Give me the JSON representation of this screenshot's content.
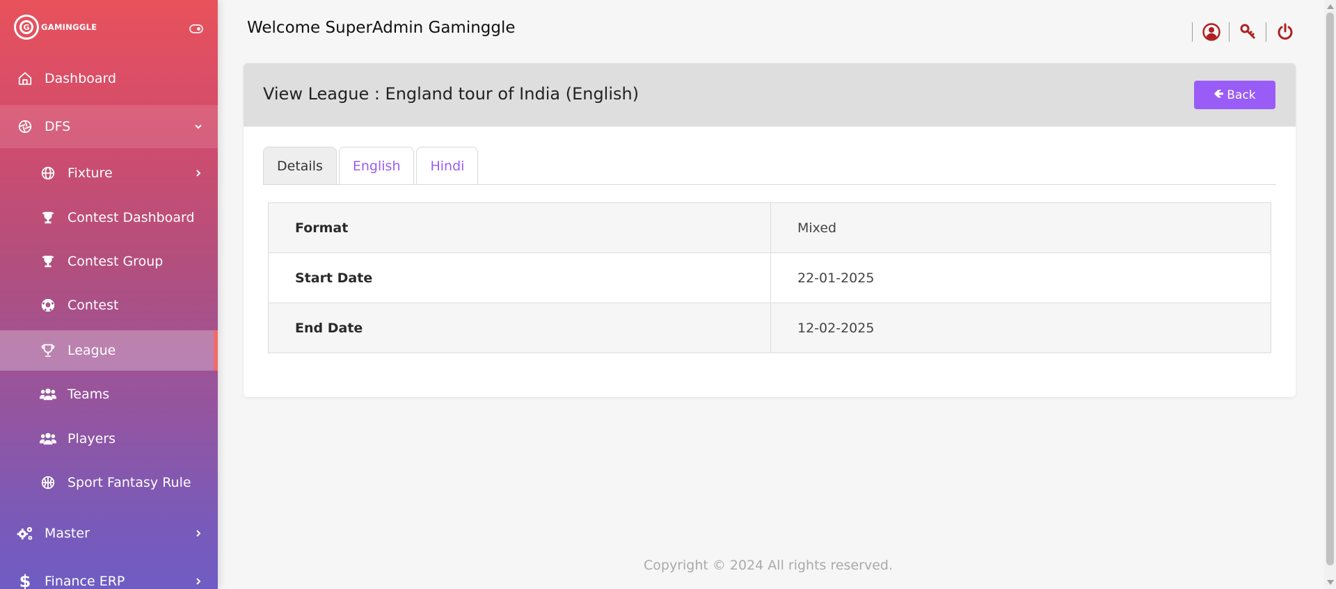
{
  "brand": {
    "name": "GAMINGGLE",
    "logo_letter": "G"
  },
  "sidebar": {
    "dashboard": "Dashboard",
    "dfs": "DFS",
    "sub_items": [
      {
        "label": "Fixture",
        "icon": "globe-icon"
      },
      {
        "label": "Contest Dashboard",
        "icon": "trophy-icon"
      },
      {
        "label": "Contest Group",
        "icon": "trophy-icon"
      },
      {
        "label": "Contest",
        "icon": "soccer-ball-icon"
      },
      {
        "label": "League",
        "icon": "trophy-icon"
      },
      {
        "label": "Teams",
        "icon": "users-icon"
      },
      {
        "label": "Players",
        "icon": "users-icon"
      },
      {
        "label": "Sport Fantasy Rule",
        "icon": "basketball-icon"
      }
    ],
    "master": "Master",
    "finance": "Finance ERP"
  },
  "header": {
    "welcome": "Welcome SuperAdmin Gaminggle"
  },
  "card": {
    "title": "View League : England tour of India (English)",
    "back_label": "Back",
    "tabs": [
      "Details",
      "English",
      "Hindi"
    ],
    "rows": [
      {
        "key": "Format",
        "value": "Mixed"
      },
      {
        "key": "Start Date",
        "value": "22-01-2025"
      },
      {
        "key": "End Date",
        "value": "12-02-2025"
      }
    ]
  },
  "footer": "Copyright © 2024  All rights reserved.",
  "colors": {
    "accent": "#9a5cf6",
    "header_icon": "#b02020",
    "active_marker": "#ef6a6a"
  }
}
